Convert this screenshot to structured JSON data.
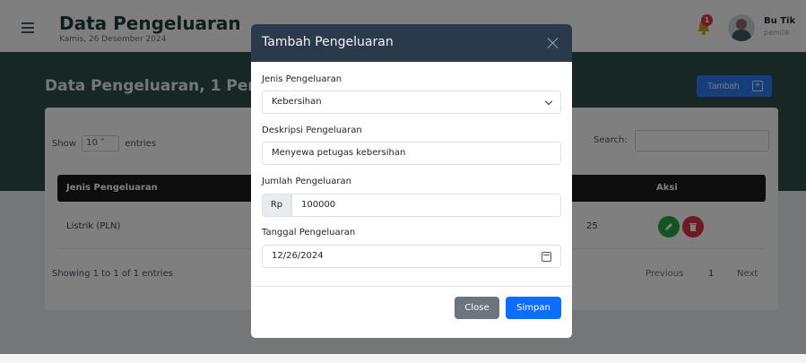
{
  "header": {
    "title": "Data Pengeluaran",
    "date": "Kamis, 26 Desember 2024",
    "notification_count": "1",
    "user_name": "Bu Tik",
    "user_role": "pemilik"
  },
  "section": {
    "title": "Data Pengeluaran, 1 Peng",
    "add_button_label": "Tambah"
  },
  "table": {
    "show_prefix": "Show",
    "show_value": "10",
    "show_suffix": "entries",
    "search_label": "Search:",
    "columns": [
      "Jenis Pengeluaran",
      "Aksi"
    ],
    "rows": [
      {
        "jenis": "Listrik (PLN)",
        "partial": "25"
      }
    ],
    "info": "Showing 1 to 1 of 1 entries",
    "pagination": {
      "previous": "Previous",
      "page": "1",
      "next": "Next"
    }
  },
  "modal": {
    "title": "Tambah Pengeluaran",
    "fields": {
      "jenis_label": "Jenis Pengeluaran",
      "jenis_value": "Kebersihan",
      "deskripsi_label": "Deskripsi Pengeluaran",
      "deskripsi_value": "Menyewa petugas kebersihan",
      "jumlah_label": "Jumlah Pengeluaran",
      "jumlah_prefix": "Rp",
      "jumlah_value": "100000",
      "tanggal_label": "Tanggal Pengeluaran",
      "tanggal_value": "12/26/2024"
    },
    "close_label": "Close",
    "save_label": "Simpan"
  },
  "colors": {
    "band": "#2e4e4c",
    "modal_header": "#2b3a4a",
    "primary": "#0d6efd",
    "secondary": "#6c757d",
    "success": "#28a745",
    "danger": "#dc3545"
  }
}
